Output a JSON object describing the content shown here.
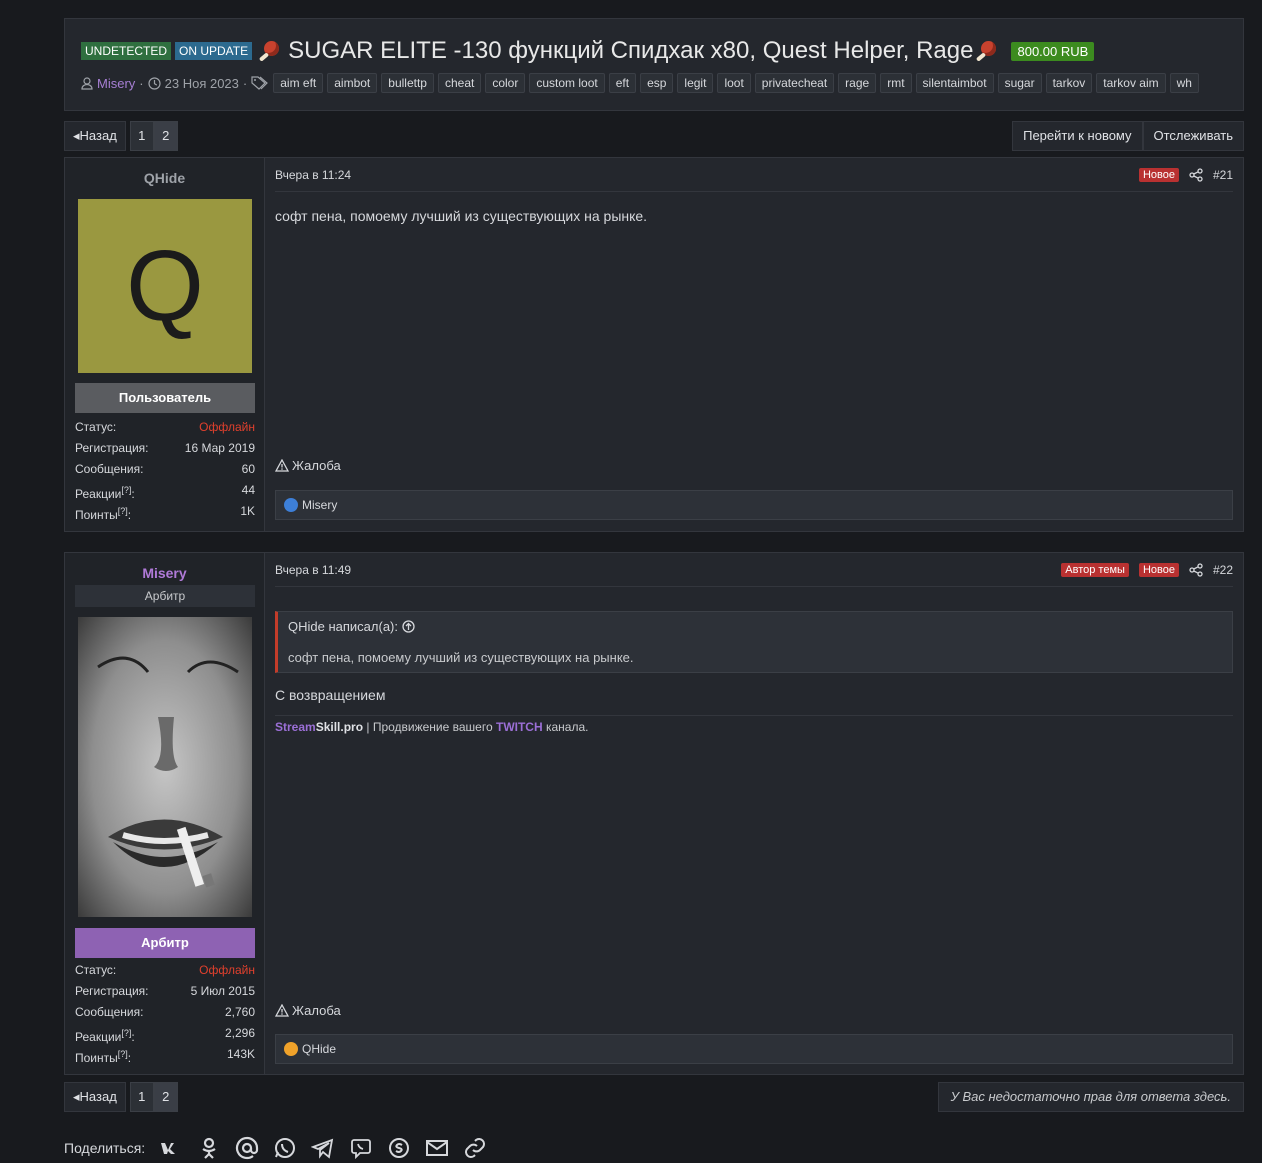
{
  "thread": {
    "prefix_1": "UNDETECTED",
    "prefix_2": "ON UPDATE",
    "title": "SUGAR ELITE -130 функций Спидхак x80, Quest Helper, Rage",
    "price": "800.00 RUB",
    "author": "Misery",
    "date": "23 Ноя 2023",
    "tags": [
      "aim eft",
      "aimbot",
      "bullettp",
      "cheat",
      "color",
      "custom loot",
      "eft",
      "esp",
      "legit",
      "loot",
      "privatecheat",
      "rage",
      "rmt",
      "silentaimbot",
      "sugar",
      "tarkov",
      "tarkov aim",
      "wh"
    ]
  },
  "pagination": {
    "back_label": "Назад",
    "pages": [
      "1",
      "2"
    ],
    "active_page": "2"
  },
  "header_actions": {
    "go_new": "Перейти к новому",
    "watch": "Отслеживать"
  },
  "posts": [
    {
      "username": "QHide",
      "avatar_letter": "Q",
      "role": "Пользователь",
      "stats": [
        {
          "label": "Статус:",
          "value": "Оффлайн"
        },
        {
          "label": "Регистрация:",
          "value": "16 Мар 2019"
        },
        {
          "label": "Сообщения:",
          "value": "60"
        },
        {
          "label": "Реакции",
          "sup": "[?]",
          "colon": ":",
          "value": "44"
        },
        {
          "label": "Поинты",
          "sup": "[?]",
          "colon": ":",
          "value": "1K"
        }
      ],
      "time": "Вчера в 11:24",
      "badge_new": "Новое",
      "number": "#21",
      "text": "софт пена, помоему лучший из существующих на рынке.",
      "report": "Жалоба",
      "reaction_user": "Misery"
    },
    {
      "username": "Misery",
      "user_title": "Арбитр",
      "role": "Арбитр",
      "stats": [
        {
          "label": "Статус:",
          "value": "Оффлайн"
        },
        {
          "label": "Регистрация:",
          "value": "5 Июл 2015"
        },
        {
          "label": "Сообщения:",
          "value": "2,760"
        },
        {
          "label": "Реакции",
          "sup": "[?]",
          "colon": ":",
          "value": "2,296"
        },
        {
          "label": "Поинты",
          "sup": "[?]",
          "colon": ":",
          "value": "143K"
        }
      ],
      "time": "Вчера в 11:49",
      "badge_author": "Автор темы",
      "badge_new": "Новое",
      "number": "#22",
      "quote_author": "QHide написал(а):",
      "quote_text": "софт пена, помоему лучший из существующих на рынке.",
      "text": "С возвращением",
      "signature": {
        "brand_1": "Stream",
        "brand_2": "Skill.pro",
        "sep": " | Продвижение вашего ",
        "twitch": "TWITCH",
        "tail": " канала."
      },
      "report": "Жалоба",
      "reaction_user": "QHide"
    }
  ],
  "footer": {
    "no_rights": "У Вас недостаточно прав для ответа здесь.",
    "share_label": "Поделиться:",
    "share_icons": [
      "vk-icon",
      "odnoklassniki-icon",
      "email-at-icon",
      "whatsapp-icon",
      "telegram-icon",
      "viber-icon",
      "skype-icon",
      "mail-icon",
      "link-icon"
    ]
  },
  "colors": {
    "accent_purple": "#a77fd4",
    "offline_red": "#e0402d",
    "price_green": "#3c8b1f",
    "badge_red": "#b93131"
  }
}
